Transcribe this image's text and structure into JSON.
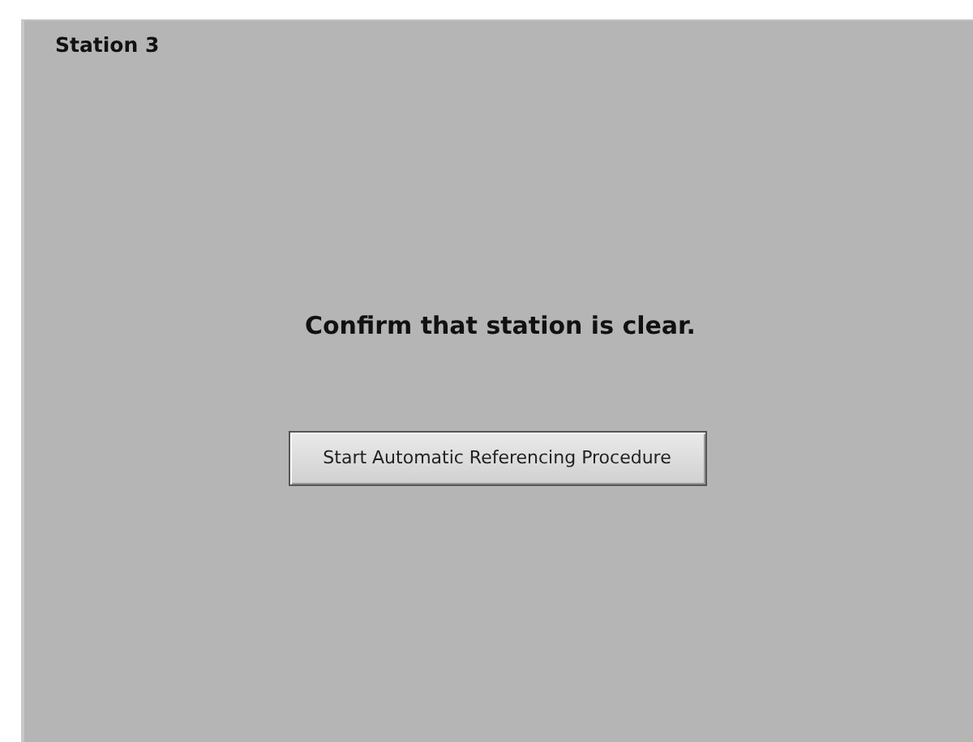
{
  "panel": {
    "title": "Station 3"
  },
  "message": "Confirm that station is clear.",
  "button": {
    "label": "Start Automatic Referencing Procedure"
  }
}
